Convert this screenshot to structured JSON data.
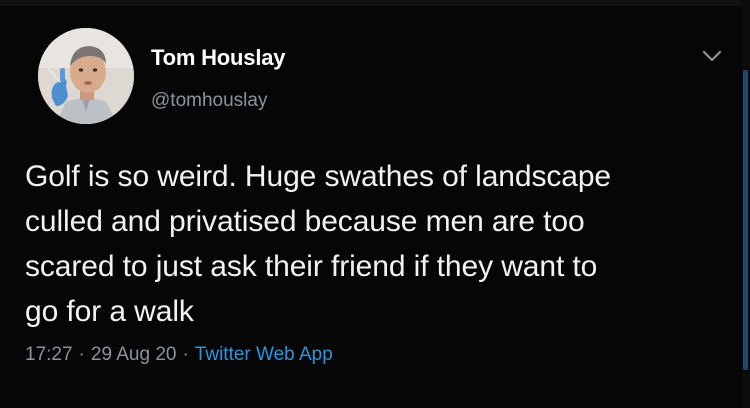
{
  "tweet": {
    "author_name": "Tom Houslay",
    "author_handle": "@tomhouslay",
    "body_lines": [
      "Golf is so weird. Huge swathes of landscape",
      "culled and privatised because men are too",
      "scared to just ask their friend if they want to",
      "go for a walk"
    ],
    "time": "17:27",
    "separator": "·",
    "date": "29 Aug 20",
    "source": "Twitter Web App"
  },
  "icons": {
    "menu": "chevron-down-icon",
    "avatar": "profile-photo"
  },
  "colors": {
    "background": "#060606",
    "text": "#f2f2f2",
    "secondary": "#8a949c",
    "link": "#2b95e0"
  }
}
